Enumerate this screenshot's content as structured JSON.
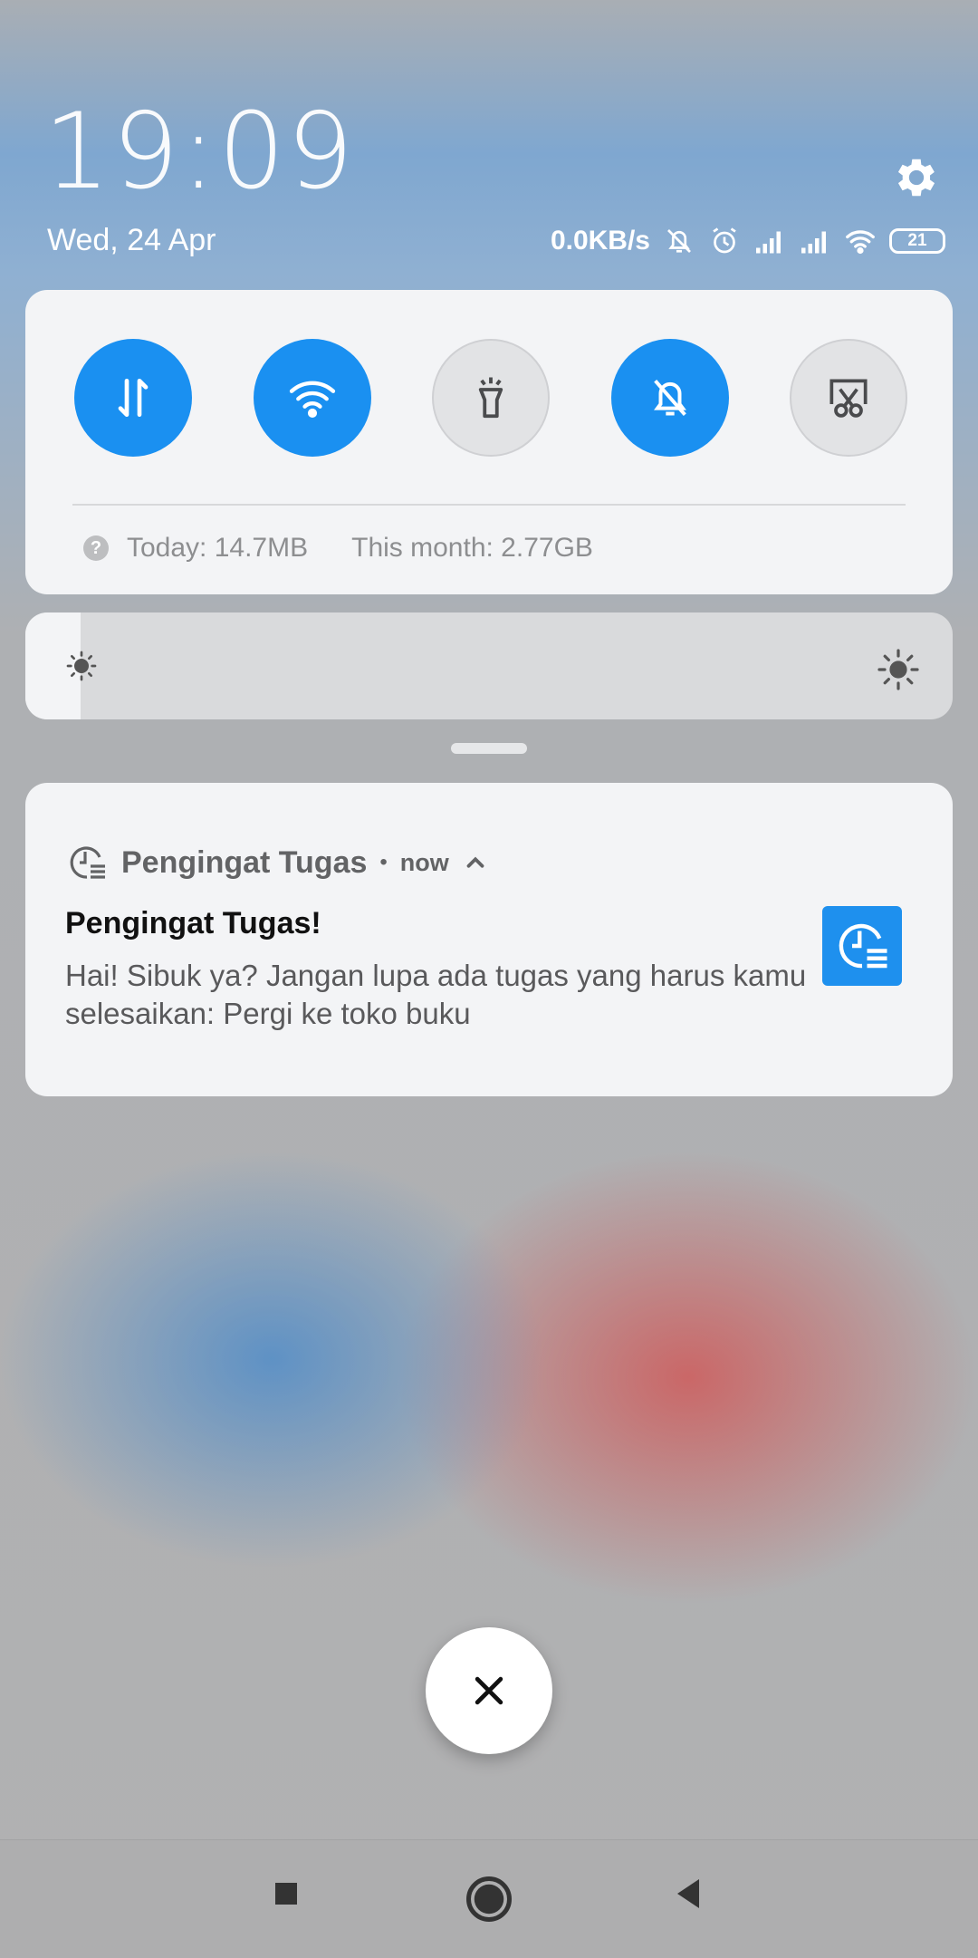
{
  "status": {
    "time": "19:09",
    "date": "Wed, 24 Apr",
    "net_speed": "0.0KB/s",
    "battery": "21",
    "icons": [
      "mute-bell-icon",
      "alarm-icon",
      "signal-icon",
      "signal-icon",
      "wifi-icon",
      "battery-icon"
    ]
  },
  "quick_settings": {
    "toggles": [
      {
        "name": "mobile-data",
        "icon": "data-arrows-icon",
        "state": "on"
      },
      {
        "name": "wifi",
        "icon": "wifi-icon",
        "state": "on"
      },
      {
        "name": "flashlight",
        "icon": "flashlight-icon",
        "state": "off"
      },
      {
        "name": "silent",
        "icon": "mute-bell-icon",
        "state": "on"
      },
      {
        "name": "screenshot",
        "icon": "scissors-screen-icon",
        "state": "off"
      }
    ],
    "usage_help": "?",
    "usage_today": "Today: 14.7MB",
    "usage_month": "This month: 2.77GB"
  },
  "brightness": {
    "level": 0.06
  },
  "notification": {
    "app_name": "Pengingat Tugas",
    "separator": "•",
    "time": "now",
    "title": "Pengingat Tugas!",
    "body": "Hai! Sibuk ya? Jangan lupa ada tugas yang harus kamu selesaikan: Pergi ke toko buku"
  },
  "colors": {
    "accent": "#1a90f1",
    "card": "#f3f4f6"
  },
  "nav": {
    "buttons": [
      "recents-icon",
      "home-icon",
      "back-icon"
    ]
  }
}
